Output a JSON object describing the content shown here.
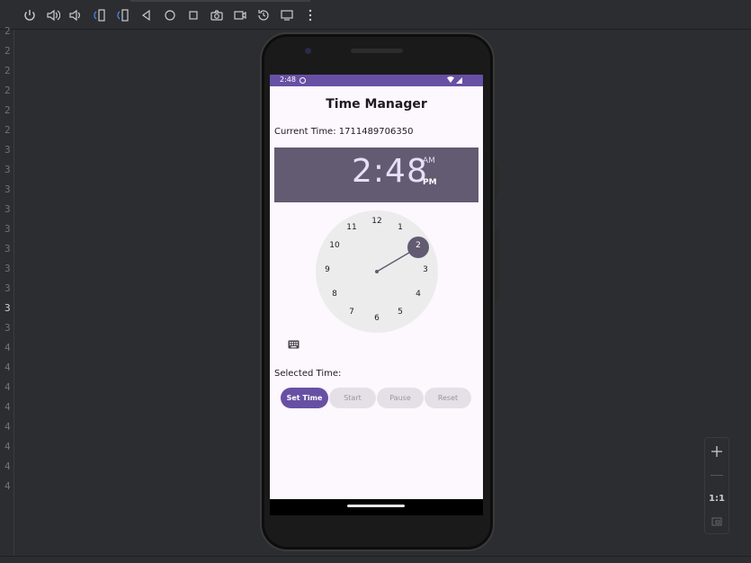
{
  "app": {
    "title": "Time Manager",
    "current_time_label": "Current Time: 1711489706350",
    "selected_time_label": "Selected Time:"
  },
  "status_bar": {
    "time": "2:48"
  },
  "time_picker": {
    "time_display": "2:48",
    "am_label": "AM",
    "pm_label": "PM",
    "selected_hour": "2",
    "dial_numbers": [
      "12",
      "1",
      "2",
      "3",
      "4",
      "5",
      "6",
      "7",
      "8",
      "9",
      "10",
      "11"
    ]
  },
  "buttons": {
    "set_time": "Set Time",
    "start": "Start",
    "pause": "Pause",
    "reset": "Reset"
  },
  "zoom": {
    "actual_size": "1:1"
  },
  "gutter": [
    "2",
    "2",
    "2",
    "2",
    "2",
    "2",
    "3",
    "3",
    "3",
    "3",
    "3",
    "3",
    "3",
    "3",
    "3",
    "3",
    "4",
    "4",
    "4",
    "4",
    "4",
    "4",
    "4",
    "4"
  ],
  "colors": {
    "primary": "#6750a4",
    "header": "#625b71",
    "surface": "#fdf7fe"
  }
}
